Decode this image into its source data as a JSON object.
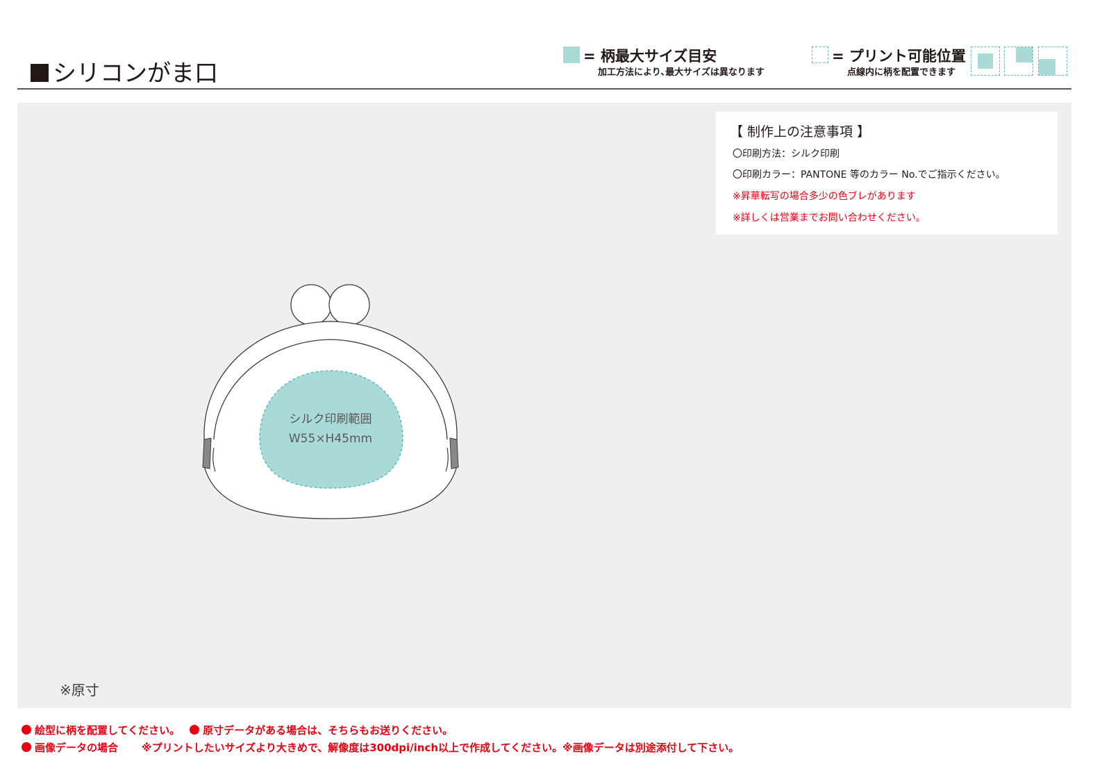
{
  "header": {
    "title": "シリコンがま口",
    "legend_max": {
      "title": "= 柄最大サイズ目安",
      "sub": "加工方法により､最大サイズは異なります"
    },
    "legend_print": {
      "title": "= プリント可能位置",
      "sub": "点線内に柄を配置できます"
    }
  },
  "notes": {
    "title": "【 制作上の注意事項 】",
    "lines": [
      "〇印刷方法：シルク印刷",
      "〇印刷カラー：PANTONE 等のカラー No.でご指示ください。",
      "※昇華転写の場合多少の色ブレがあります",
      "※詳しくは営業までお問い合わせください。"
    ]
  },
  "print_area": {
    "label": "シルク印刷範囲",
    "size": "W55×H45mm"
  },
  "genpo": "※原寸",
  "footer": {
    "line1_a": "絵型に柄を配置してください。",
    "line1_b": "原寸データがある場合は、そちらもお送りください。",
    "line2_a": "画像データの場合",
    "line2_b": "※プリントしたいサイズより大きめで、解像度は300dpi/inch以上で作成してください。※画像データは別途添付して下さい。"
  },
  "colors": {
    "print_area": "#a9dad8",
    "print_border": "#5cbcc0",
    "warning": "#e60012"
  }
}
